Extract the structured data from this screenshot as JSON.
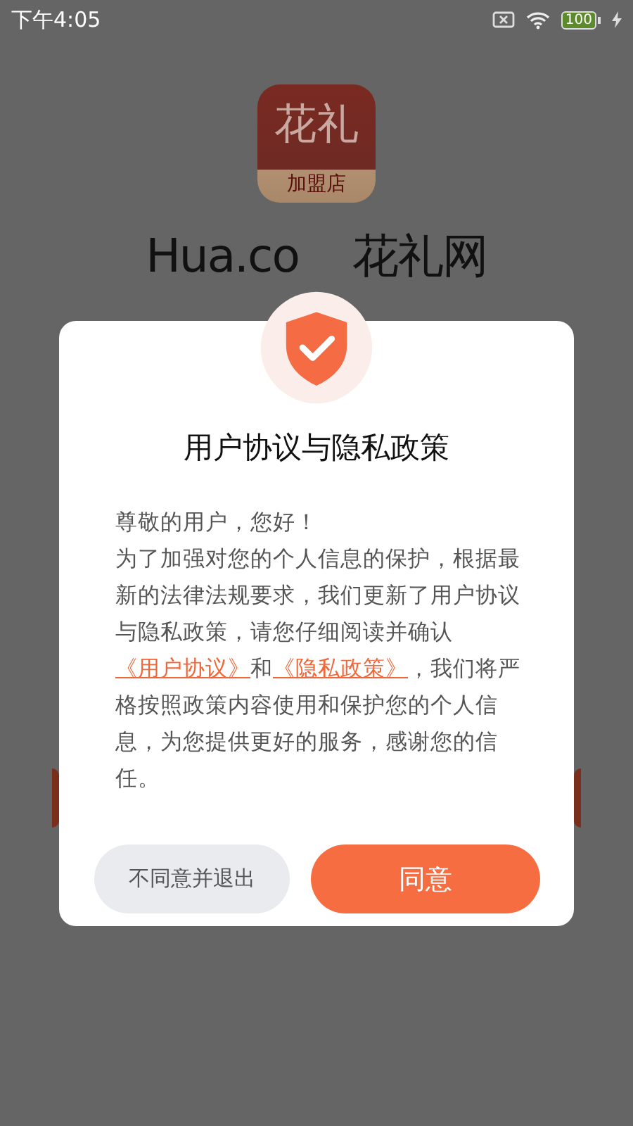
{
  "status_bar": {
    "time": "下午4:05",
    "battery": "100"
  },
  "background_app": {
    "logo_top": "花礼",
    "logo_bottom": "加盟店",
    "brand": [
      "Hua.co",
      "花礼网"
    ]
  },
  "dialog": {
    "title": "用户协议与隐私政策",
    "greeting": "尊敬的用户，您好！",
    "body": [
      {
        "kind": "text",
        "text": "为了加强对您的个人信息的保护，根据最新的法律法规要求，我们更新了用户协议与隐私政策，请您仔细阅读并确认"
      },
      {
        "kind": "link",
        "text": "《用户协议》"
      },
      {
        "kind": "text",
        "text": "和"
      },
      {
        "kind": "link",
        "text": "《隐私政策》"
      },
      {
        "kind": "text",
        "text": "，我们将严格按照政策内容使用和保护您的个人信息，为您提供更好的服务，感谢您的信任。"
      }
    ],
    "buttons": [
      {
        "kind": "secondary",
        "label": "不同意并退出"
      },
      {
        "kind": "primary",
        "label": "同意"
      }
    ]
  }
}
